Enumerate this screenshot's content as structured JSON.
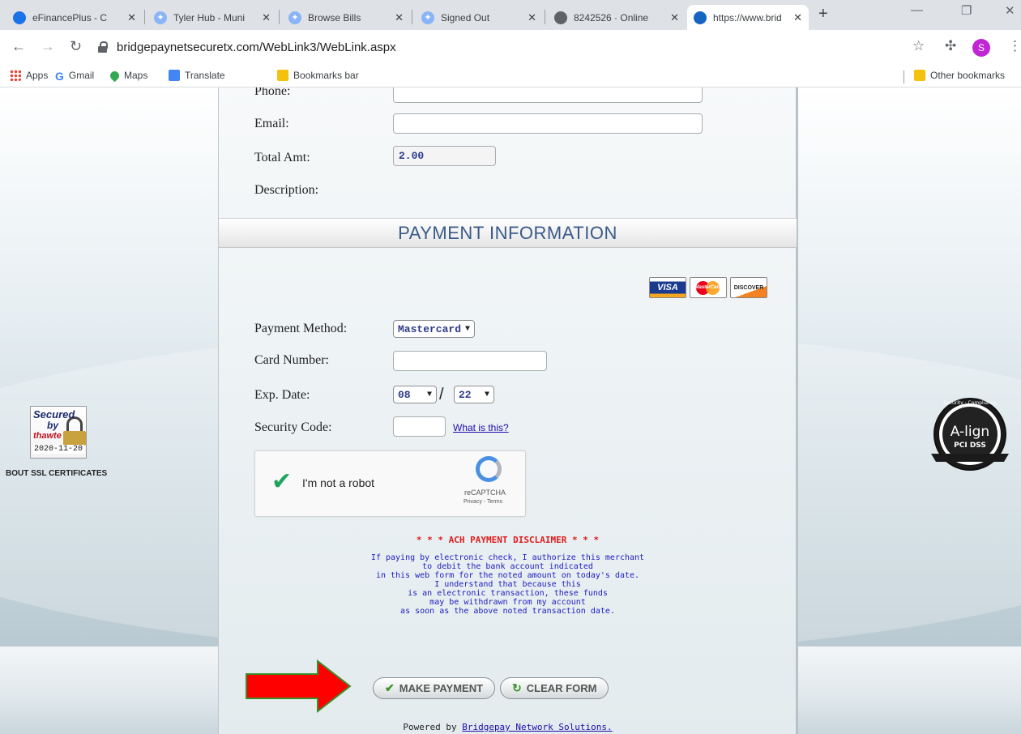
{
  "browser": {
    "tabs": [
      {
        "label": "eFinancePlus - C",
        "icon": "globe-icon",
        "color": "#1a73e8"
      },
      {
        "label": "Tyler Hub - Muni",
        "icon": "tyler-icon",
        "color": "#8ab4f8"
      },
      {
        "label": "Browse Bills",
        "icon": "tyler-icon",
        "color": "#8ab4f8"
      },
      {
        "label": "Signed Out",
        "icon": "tyler-icon",
        "color": "#8ab4f8"
      },
      {
        "label": "8242526 · Online",
        "icon": "globe-icon",
        "color": "#5f6368"
      },
      {
        "label": "https://www.brid",
        "icon": "bridgepay-icon",
        "color": "#1565c0"
      }
    ],
    "url": "bridgepaynetsecuretx.com/WebLink3/WebLink.aspx",
    "profile_initial": "S",
    "bookmarks": {
      "apps": "Apps",
      "gmail": "Gmail",
      "maps": "Maps",
      "translate": "Translate",
      "bookmarks_bar": "Bookmarks bar",
      "other": "Other bookmarks"
    }
  },
  "form": {
    "phone_label": "Phone:",
    "email_label": "Email:",
    "email_value": "",
    "total_label": "Total Amt:",
    "total_value": "2.00",
    "description_label": "Description:"
  },
  "payment": {
    "section_title": "PAYMENT INFORMATION",
    "cards": [
      "VISA",
      "MasterCard",
      "DISCOVER"
    ],
    "method_label": "Payment Method:",
    "method_value": "Mastercard",
    "card_number_label": "Card Number:",
    "card_number_value": "",
    "exp_label": "Exp. Date:",
    "exp_month": "08",
    "exp_separator": "/",
    "exp_year": "22",
    "security_label": "Security Code:",
    "security_value": "",
    "what_is_this": "What is this?"
  },
  "captcha": {
    "text": "I'm not a robot",
    "brand": "reCAPTCHA",
    "terms": "Privacy - Terms"
  },
  "disclaimer": {
    "title": "* * * ACH PAYMENT DISCLAIMER * * *",
    "lines": [
      "If paying by electronic check, I authorize this merchant",
      "to debit the bank account indicated",
      "in this web form for the noted amount on today's date.",
      "I understand that because this",
      "is an electronic transaction, these funds",
      "may be withdrawn from my account",
      "as soon as the above noted transaction date."
    ]
  },
  "buttons": {
    "make_payment": "MAKE PAYMENT",
    "clear_form": "CLEAR FORM"
  },
  "footer": {
    "powered_prefix": "Powered by ",
    "powered_link": "Bridgepay Network Solutions."
  },
  "badges": {
    "thawte_secured": "Secured",
    "thawte_by": "by",
    "thawte_brand": "thawte",
    "thawte_date": "2020-11-20",
    "ssl_about": "BOUT SSL CERTIFICATES",
    "pci_brand": "A-lign",
    "pci_label": "PCI DSS",
    "pci_top": "Security · Compliance"
  },
  "colors": {
    "accent_blue": "#3a5a8a",
    "disclaimer_red": "#e01b1b",
    "disclaimer_blue": "#2020c0",
    "arrow_red": "#ff0000",
    "arrow_border": "#3a8f2a"
  }
}
